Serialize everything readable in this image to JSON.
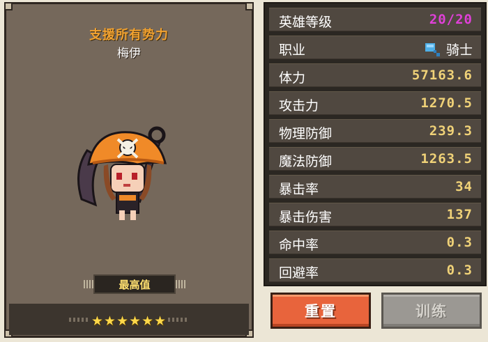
{
  "hero": {
    "faction": "支援所有势力",
    "name": "梅伊",
    "max_label": "最高值",
    "stars": "★★★★★★"
  },
  "stats": {
    "rows": [
      {
        "label": "英雄等级",
        "value": "20/20"
      },
      {
        "label": "职业",
        "value": "骑士"
      },
      {
        "label": "体力",
        "value": "57163.6"
      },
      {
        "label": "攻击力",
        "value": "1270.5"
      },
      {
        "label": "物理防御",
        "value": "239.3"
      },
      {
        "label": "魔法防御",
        "value": "1263.5"
      },
      {
        "label": "暴击率",
        "value": "34"
      },
      {
        "label": "暴击伤害",
        "value": "137"
      },
      {
        "label": "命中率",
        "value": "0.3"
      },
      {
        "label": "回避率",
        "value": "0.3"
      }
    ]
  },
  "buttons": {
    "reset": "重置",
    "train": "训练"
  },
  "colors": {
    "level_value": "#e040d8",
    "stat_value": "#f0d278",
    "faction_text": "#f2a230",
    "reset_button": "#e8643c",
    "train_button_disabled": "#9b9893"
  },
  "icons": {
    "class_icon": "knight-hammer-icon"
  }
}
